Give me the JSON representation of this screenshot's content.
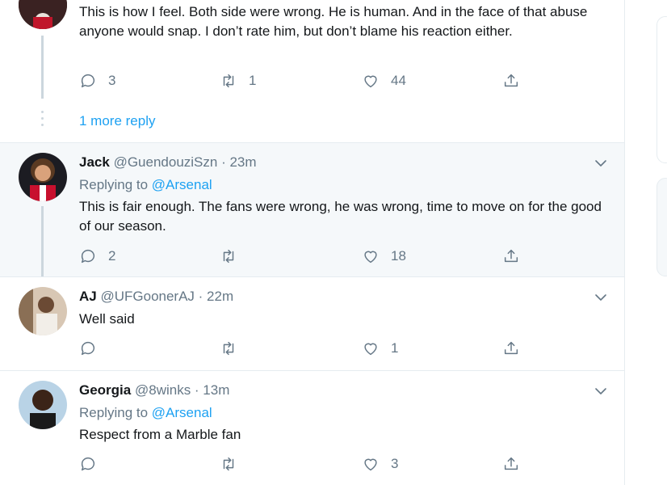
{
  "tweets": [
    {
      "text": "This is how I feel. Both side were wrong. He is human. And in the face of that abuse anyone would snap. I don’t rate him, but don’t blame his reaction either.",
      "replies": "3",
      "retweets": "1",
      "likes": "44",
      "more_reply": "1 more reply"
    },
    {
      "name": "Jack",
      "handle": "@GuendouziSzn · 23m",
      "replying_label": "Replying to",
      "replying_to": "@Arsenal",
      "text": "This is fair enough. The fans were wrong, he was wrong, time to move on for the good of our season.",
      "replies": "2",
      "retweets": "",
      "likes": "18"
    },
    {
      "name": "AJ",
      "handle": "@UFGoonerAJ · 22m",
      "text": "Well said",
      "replies": "",
      "retweets": "",
      "likes": "1"
    },
    {
      "name": "Georgia",
      "handle": "@8winks · 13m",
      "replying_label": "Replying to",
      "replying_to": "@Arsenal",
      "text": "Respect from a Marble fan",
      "replies": "",
      "retweets": "",
      "likes": "3"
    }
  ],
  "icons": {
    "reply": "reply-icon",
    "retweet": "retweet-icon",
    "like": "like-icon",
    "share": "share-icon",
    "caret": "chevron-down-icon"
  },
  "colors": {
    "accent": "#1da1f2",
    "secondary_text": "#657786",
    "highlight_bg": "#f5f8fa"
  }
}
